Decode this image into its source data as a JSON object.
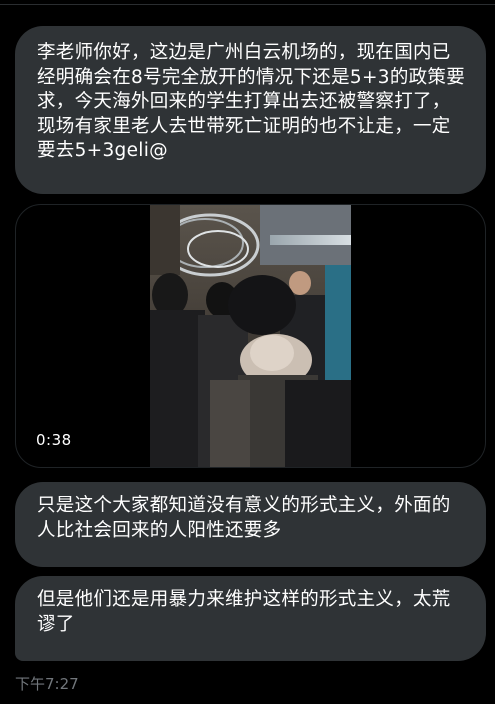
{
  "messages": [
    {
      "text": "李老师你好，这边是广州白云机场的，现在国内已经明确会在8号完全放开的情况下还是5+3的政策要求，今天海外回来的学生打算出去还被警察打了，现场有家里老人去世带死亡证明的也不让走，一定要去5+3geli@"
    },
    {
      "text": "只是这个大家都知道没有意义的形式主义，外面的人比社会回来的人阳性还要多"
    },
    {
      "text": "但是他们还是用暴力来维护这样的形式主义，太荒谬了"
    }
  ],
  "video": {
    "duration": "0:38"
  },
  "timestamp": "下午7:27",
  "colors": {
    "background": "#000000",
    "bubble": "#2f3336",
    "text": "#ffffff",
    "muted": "#71767b"
  }
}
